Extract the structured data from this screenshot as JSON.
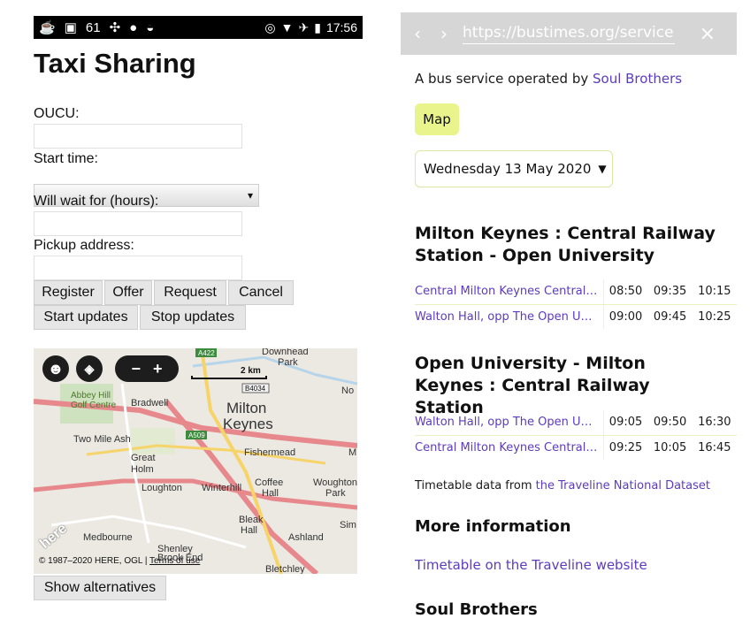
{
  "left": {
    "status": {
      "time": "17:56",
      "notification_icons": [
        "cup",
        "image",
        "61",
        "fan",
        "drop",
        "android"
      ]
    },
    "title": "Taxi Sharing",
    "form": {
      "oucu_label": "OUCU:",
      "start_time_label": "Start time:",
      "wait_label": "Will wait for (hours):",
      "pickup_label": "Pickup address:",
      "select_arrow": "▾"
    },
    "buttons": {
      "register": "Register",
      "offer": "Offer",
      "request": "Request",
      "cancel": "Cancel",
      "start_updates": "Start updates",
      "stop_updates": "Stop updates",
      "show_alternatives": "Show alternatives"
    },
    "map": {
      "scale": "2 km",
      "labels": [
        "Abbey Hill Golf Centre",
        "Bradwell",
        "Milton",
        "Keynes",
        "Two Mile Ash",
        "Great",
        "Holm",
        "Loughton",
        "Winterhill",
        "Coffee",
        "Hall",
        "Fishermead",
        "Woughton",
        "Park",
        "Bleak",
        "Hall",
        "Ashland",
        "Medbourne",
        "Shenley Brook End",
        "Downhead",
        "Park",
        "No",
        "Sim",
        "M",
        "Bletchley"
      ],
      "road_shields": [
        "A422",
        "B4034",
        "A509"
      ],
      "logo": "here",
      "copyright": "© 1987–2020 HERE, OGL | ",
      "terms": "Terms of use"
    }
  },
  "right": {
    "url": "https://bustimes.org/service",
    "operator_prefix": "A bus service operated by ",
    "operator_name": "Soul Brothers",
    "map_button": "Map",
    "date_select": "Wednesday 13 May 2020",
    "date_arrow": "▼",
    "route1": {
      "title": "Milton Keynes : Central Railway Station - Open University",
      "rows": [
        {
          "stop": "Central Milton Keynes Central…",
          "times": [
            "08:50",
            "09:35",
            "10:15"
          ]
        },
        {
          "stop": "Walton Hall, opp The Open U…",
          "times": [
            "09:00",
            "09:45",
            "10:25"
          ]
        }
      ]
    },
    "route2": {
      "title": "Open University - Milton Keynes : Central Railway Station",
      "rows": [
        {
          "stop": "Walton Hall, opp The Open U…",
          "times": [
            "09:05",
            "09:50",
            "16:30"
          ]
        },
        {
          "stop": "Central Milton Keynes Central…",
          "times": [
            "09:25",
            "10:05",
            "16:45"
          ]
        }
      ]
    },
    "data_source_prefix": "Timetable data from ",
    "data_source_link": "the Traveline National Dataset",
    "more_info_heading": "More information",
    "traveline_link": "Timetable on the Traveline website",
    "operator_heading": "Soul Brothers"
  },
  "colors": {
    "link": "#5c3bbf",
    "map_button": "#eaf48c",
    "urlbar": "#d6d6d6",
    "statusbar": "#000000"
  }
}
